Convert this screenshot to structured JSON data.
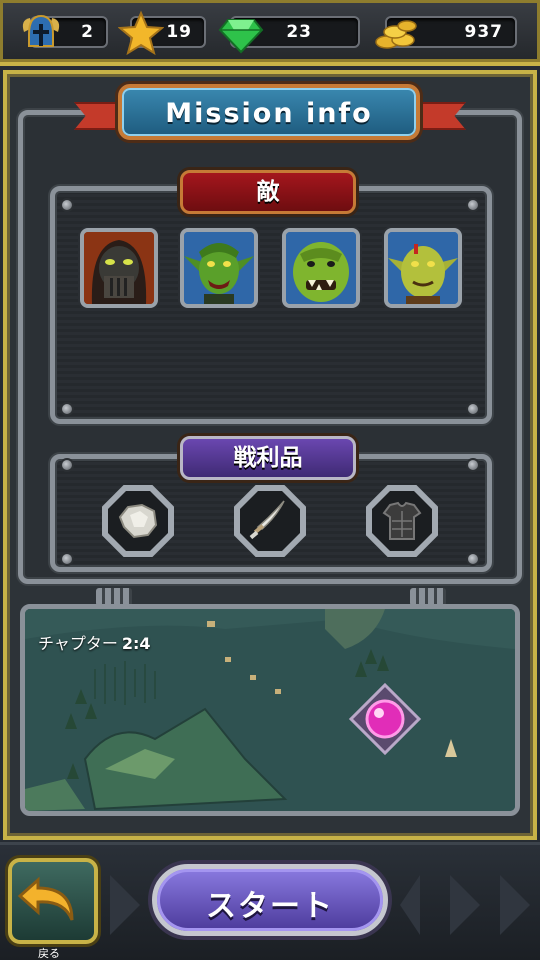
{
  "resources": {
    "helmet": "2",
    "stars": "19",
    "gems": "23",
    "coins": "937"
  },
  "panel": {
    "title": "Mission info",
    "enemies_label": "敵",
    "loot_label": "戦利品",
    "enemies": [
      {
        "icon": "hooded-dark-enemy-icon"
      },
      {
        "icon": "green-goblin-enemy-icon"
      },
      {
        "icon": "green-orc-enemy-icon"
      },
      {
        "icon": "yellow-orc-enemy-icon"
      }
    ],
    "loot": [
      {
        "icon": "ore-rock-icon"
      },
      {
        "icon": "curved-sword-icon"
      },
      {
        "icon": "armor-vest-icon"
      }
    ]
  },
  "map": {
    "chapter_label": "チャプター",
    "chapter_value": "2:4"
  },
  "bottom": {
    "back_label": "戻る",
    "start_label": "スタート"
  },
  "colors": {
    "gold_border": "#c8b347",
    "title_blue": "#2a76a0",
    "enemy_header_red": "#a4161d",
    "loot_header_purple": "#5a3d9c",
    "start_button": "#6e5cc8"
  }
}
